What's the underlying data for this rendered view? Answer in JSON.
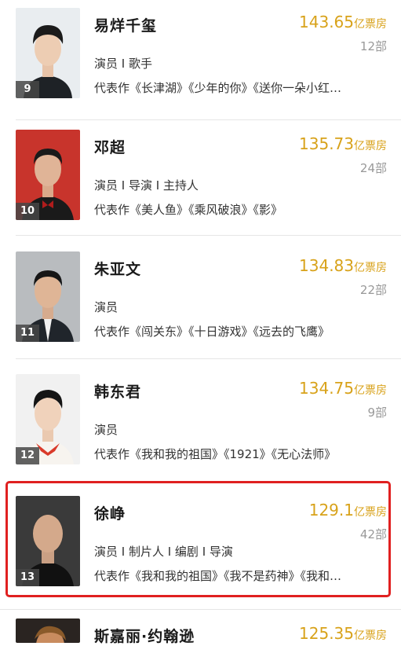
{
  "actors": [
    {
      "rank": "9",
      "name": "易烊千玺",
      "box_office": "143.65",
      "unit": "亿票房",
      "films": "12部",
      "roles": "演员 I 歌手",
      "works": "代表作《长津湖》《少年的你》《送你一朵小红…"
    },
    {
      "rank": "10",
      "name": "邓超",
      "box_office": "135.73",
      "unit": "亿票房",
      "films": "24部",
      "roles": "演员 I 导演 I 主持人",
      "works": "代表作《美人鱼》《乘风破浪》《影》"
    },
    {
      "rank": "11",
      "name": "朱亚文",
      "box_office": "134.83",
      "unit": "亿票房",
      "films": "22部",
      "roles": "演员",
      "works": "代表作《闯关东》《十日游戏》《远去的飞鹰》"
    },
    {
      "rank": "12",
      "name": "韩东君",
      "box_office": "134.75",
      "unit": "亿票房",
      "films": "9部",
      "roles": "演员",
      "works": "代表作《我和我的祖国》《1921》《无心法师》"
    },
    {
      "rank": "13",
      "name": "徐峥",
      "box_office": "129.1",
      "unit": "亿票房",
      "films": "42部",
      "roles": "演员 I 制片人 I 编剧 I 导演",
      "works": "代表作《我和我的祖国》《我不是药神》《我和…"
    },
    {
      "rank": "",
      "name": "斯嘉丽·约翰逊",
      "box_office": "125.35",
      "unit": "亿票房",
      "films": "",
      "roles": "",
      "works": ""
    }
  ],
  "colors": {
    "accent": "#d8a21a",
    "highlight": "#e02020"
  }
}
